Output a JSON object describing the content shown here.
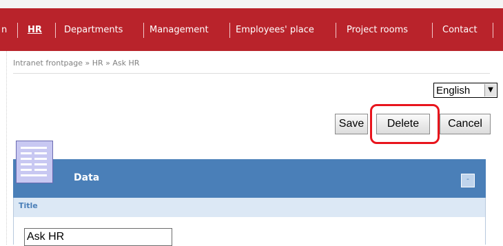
{
  "nav": {
    "partial_first": "n",
    "items": [
      "HR",
      "Departments",
      "Management",
      "Employees' place",
      "Project rooms",
      "Contact"
    ],
    "active": "HR"
  },
  "breadcrumb": {
    "text": "Intranet frontpage  »  HR  »  Ask HR"
  },
  "language": {
    "selected": "English",
    "arrow": "▼"
  },
  "actions": {
    "save": "Save",
    "delete": "Delete",
    "cancel": "Cancel"
  },
  "panel": {
    "title": "Data",
    "collapse_label": "-",
    "icon": "document-list-icon"
  },
  "form": {
    "section_label": "Title",
    "title_value": "Ask HR"
  },
  "colors": {
    "nav_bg": "#b9232b",
    "panel_header": "#4a7fb8",
    "section_bg": "#dce8f5",
    "highlight": "#e8141c"
  }
}
